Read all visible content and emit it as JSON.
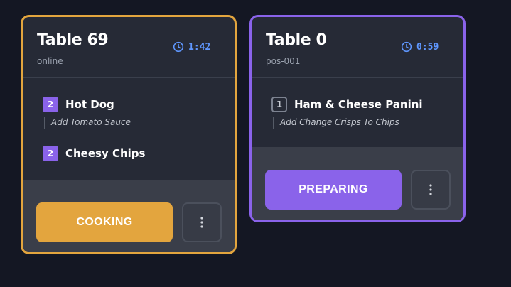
{
  "orders": [
    {
      "table": "Table 69",
      "source": "online",
      "timer": "1:42",
      "items": [
        {
          "qty": "2",
          "name": "Hot Dog",
          "modifier": "Add Tomato Sauce"
        },
        {
          "qty": "2",
          "name": "Cheesy Chips"
        }
      ],
      "action": "COOKING"
    },
    {
      "table": "Table 0",
      "source": "pos-001",
      "timer": "0:59",
      "items": [
        {
          "qty": "1",
          "name": "Ham & Cheese Panini",
          "modifier": "Add Change Crisps To Chips"
        }
      ],
      "action": "PREPARING"
    }
  ],
  "icons": {
    "timer": "clock-icon",
    "more": "more-vertical-icon"
  },
  "colors": {
    "background": "#141723",
    "card": "#262a36",
    "cooking_accent": "#e3a53e",
    "preparing_accent": "#8a63ea",
    "timer": "#5f97ff"
  }
}
